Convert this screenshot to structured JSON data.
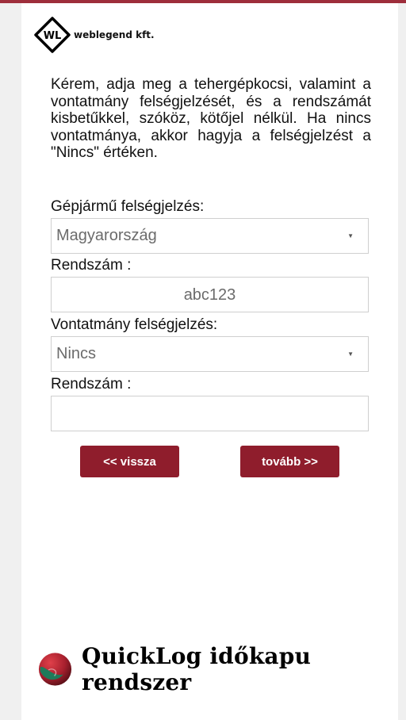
{
  "brand": {
    "name": "weblegend kft.",
    "mark_text": "WL"
  },
  "intro_text": "Kérem, adja meg a tehergépkocsi, valamint a vontatmány felségjelzését, és a rendszámát kisbetűkkel, szóköz, kötőjel nélkül. Ha nincs vontatmánya, akkor hagyja a felségjelzést a \"Nincs\" értéken.",
  "vehicle": {
    "country_label": "Gépjármű felségjelzés:",
    "country_value": "Magyarország",
    "plate_label": "Rendszám :",
    "plate_value": "abc123"
  },
  "trailer": {
    "country_label": "Vontatmány felségjelzés:",
    "country_value": "Nincs",
    "plate_label": "Rendszám :",
    "plate_value": ""
  },
  "buttons": {
    "back": "<< vissza",
    "next": "tovább >>"
  },
  "footer": {
    "product": "QuickLog időkapu rendszer"
  },
  "colors": {
    "accent": "#8f1d2c",
    "topbar": "#9e2e3b"
  }
}
